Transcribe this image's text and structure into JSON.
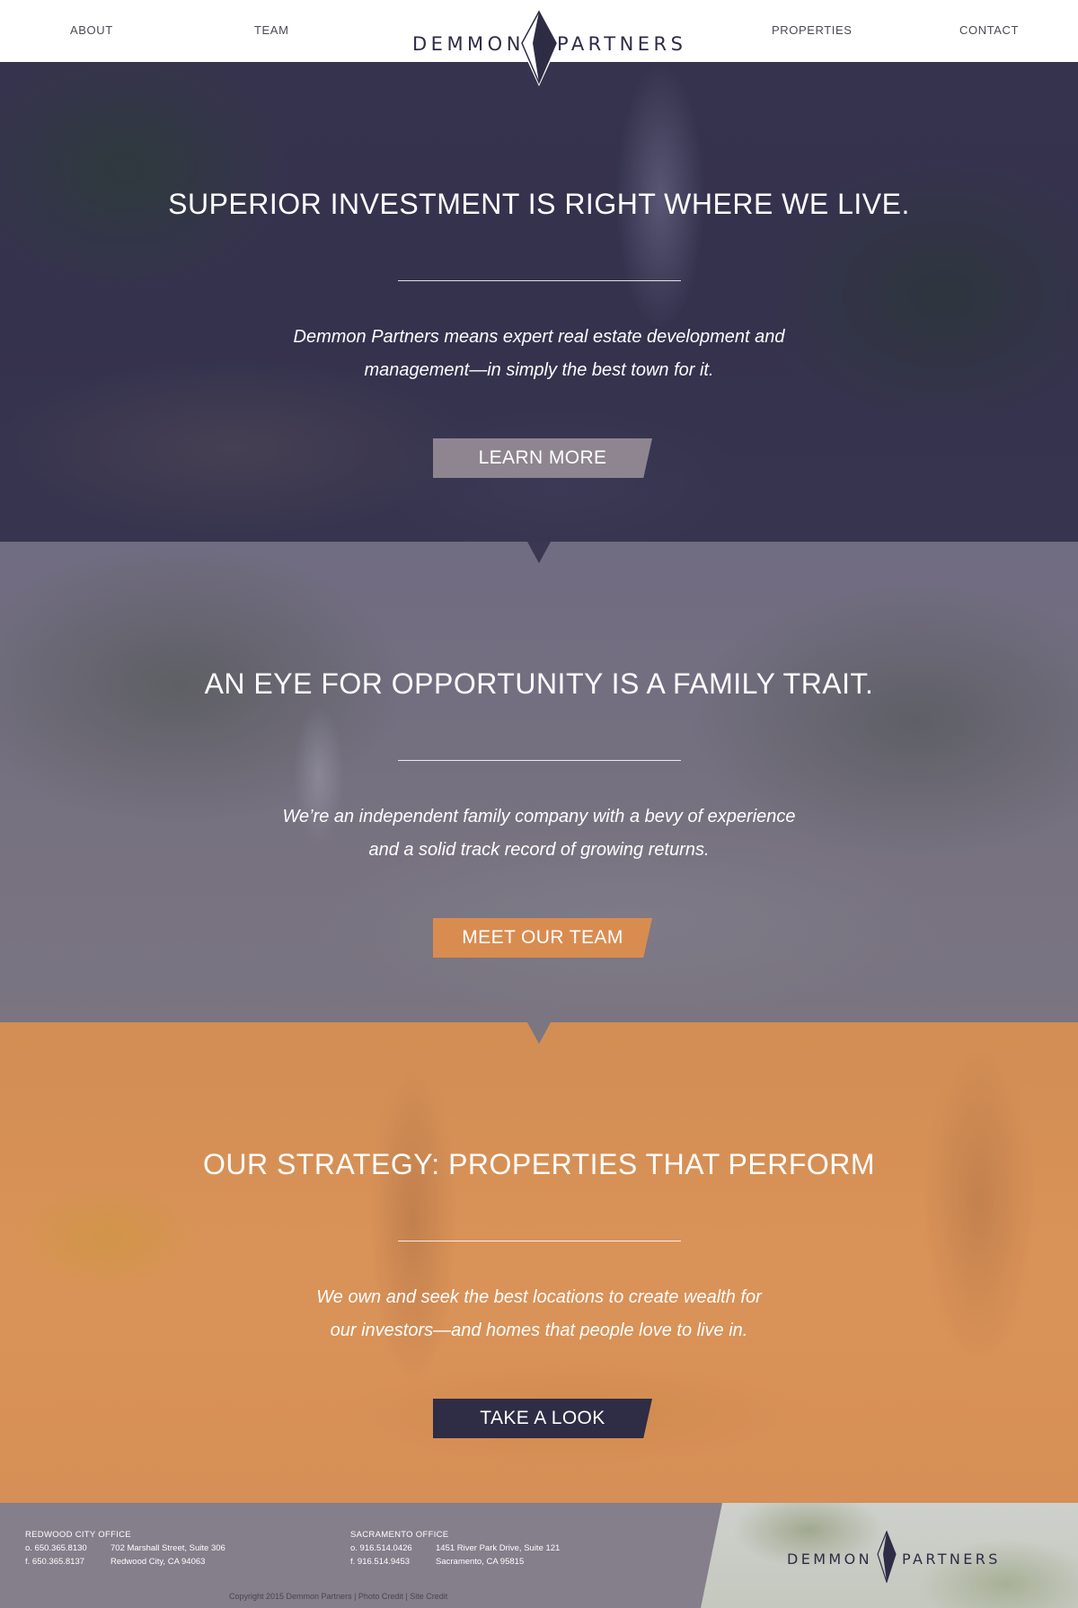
{
  "nav": {
    "items": [
      {
        "label": "ABOUT"
      },
      {
        "label": "TEAM"
      },
      {
        "label": "PROPERTIES"
      },
      {
        "label": "CONTACT"
      }
    ],
    "logo": {
      "left": "DEMMON",
      "right": "PARTNERS",
      "icon": "diamond-logo-icon"
    }
  },
  "sections": [
    {
      "headline": "SUPERIOR INVESTMENT IS RIGHT WHERE WE LIVE.",
      "text_line1": "Demmon Partners means expert real estate development and",
      "text_line2": "management—in simply the best town for it.",
      "button": "LEARN MORE",
      "button_color": "#8e8591",
      "tint_color": "#3b3752"
    },
    {
      "headline": "AN EYE FOR OPPORTUNITY IS A FAMILY TRAIT.",
      "text_line1": "We’re an independent family company with a bevy of experience",
      "text_line2": "and a solid track record of growing returns.",
      "button": "MEET OUR TEAM",
      "button_color": "#d98c50",
      "tint_color": "#7b7681"
    },
    {
      "headline": "OUR STRATEGY: PROPERTIES THAT PERFORM",
      "text_line1": "We own and seek the best locations to create wealth for",
      "text_line2": "our investors—and homes that people love to live in.",
      "button": "TAKE A LOOK",
      "button_color": "#2f2c46",
      "tint_color": "#d48f57"
    }
  ],
  "footer": {
    "offices": [
      {
        "title": "REDWOOD CITY OFFICE",
        "phone": "o. 650.365.8130",
        "fax": "f. 650.365.8137",
        "address1": "702 Marshall Street, Suite 306",
        "address2": "Redwood City, CA 94063"
      },
      {
        "title": "SACRAMENTO OFFICE",
        "phone": "o. 916.514.0426",
        "fax": "f. 916.514.9453",
        "address1": "1451 River Park Drive, Suite 121",
        "address2": "Sacramento, CA 95815"
      }
    ],
    "copyright": "Copyright 2015 Demmon Partners | Photo Credit | Site Credit",
    "logo": {
      "left": "DEMMON",
      "right": "PARTNERS"
    }
  }
}
